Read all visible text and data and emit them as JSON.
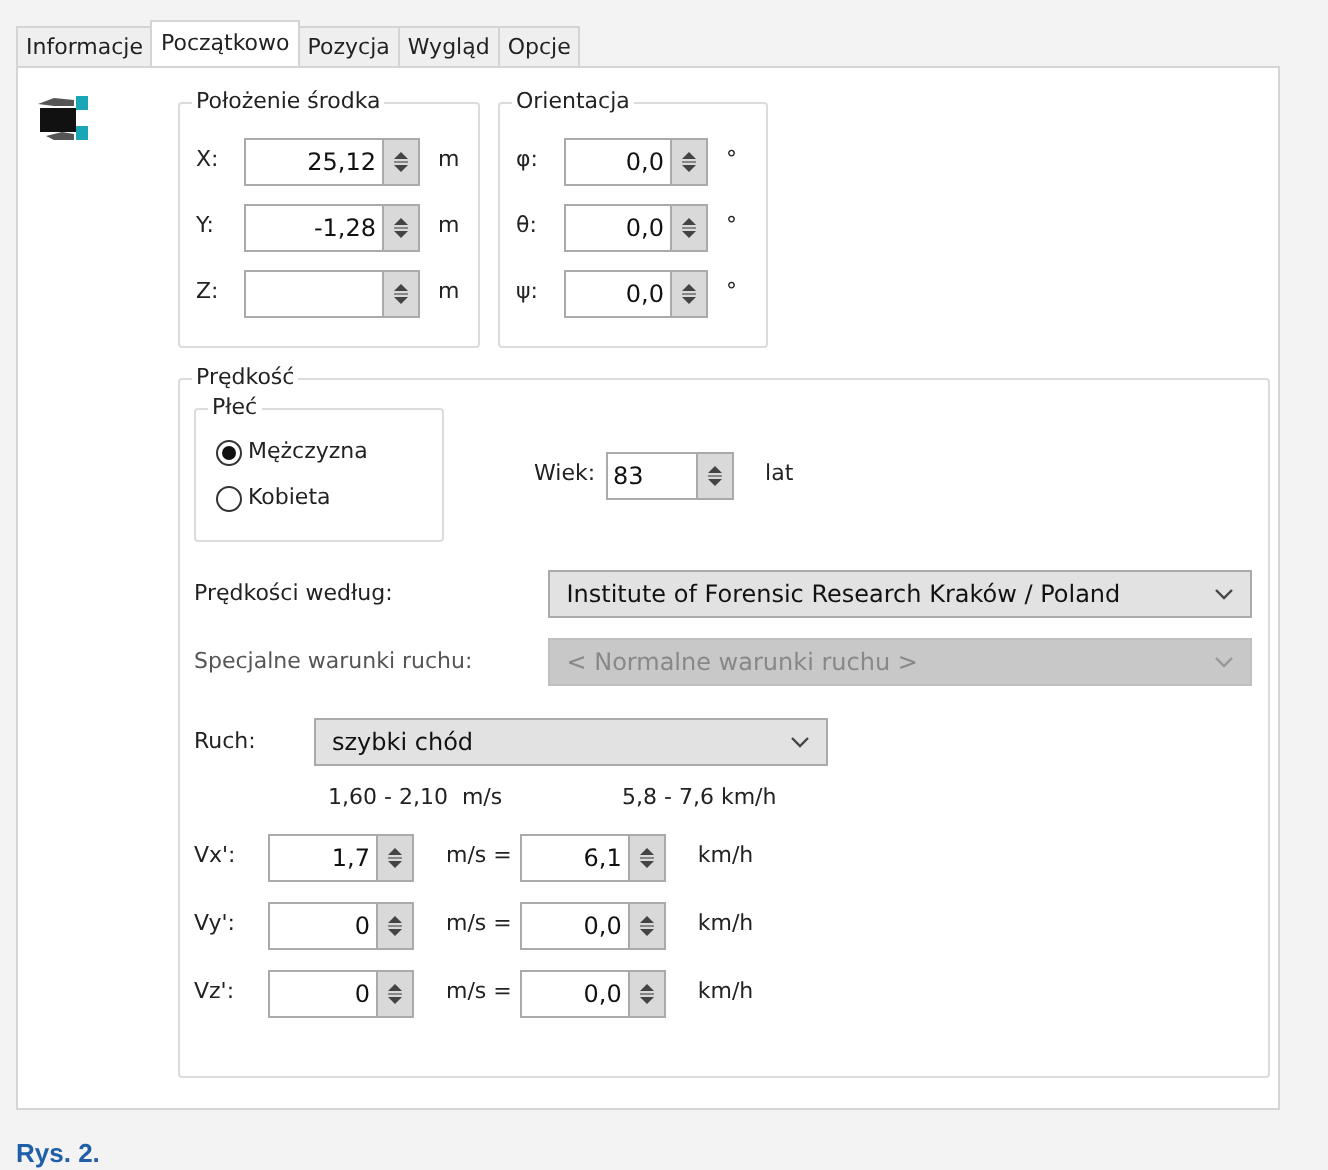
{
  "tabs": [
    {
      "label": "Informacje",
      "selected": false
    },
    {
      "label": "Początkowo",
      "selected": true
    },
    {
      "label": "Pozycja",
      "selected": false
    },
    {
      "label": "Wygląd",
      "selected": false
    },
    {
      "label": "Opcje",
      "selected": false
    }
  ],
  "position": {
    "title": "Położenie środka",
    "fields": [
      {
        "label": "X:",
        "value": "25,12",
        "unit": "m"
      },
      {
        "label": "Y:",
        "value": "-1,28",
        "unit": "m"
      },
      {
        "label": "Z:",
        "unit": "m"
      }
    ]
  },
  "orientation": {
    "title": "Orientacja",
    "fields": [
      {
        "label": "φ:",
        "value": "0,0",
        "unit": "°"
      },
      {
        "label": "θ:",
        "value": "0,0",
        "unit": "°"
      },
      {
        "label": "ψ:",
        "value": "0,0",
        "unit": "°"
      }
    ]
  },
  "speed": {
    "title": "Prędkość",
    "gender": {
      "title": "Płeć",
      "options": [
        {
          "label": "Mężczyzna",
          "selected": true
        },
        {
          "label": "Kobieta",
          "selected": false
        }
      ]
    },
    "age": {
      "label": "Wiek:",
      "value": "83",
      "unit": "lat"
    },
    "selects": [
      {
        "label": "Prędkości według:",
        "value": "Institute of Forensic Research Kraków / Poland",
        "disabled": false
      },
      {
        "label": "Specjalne warunki ruchu:",
        "value": "< Normalne warunki ruchu >",
        "disabled": true
      }
    ],
    "movement": {
      "label": "Ruch:",
      "value": "szybki chód"
    },
    "range_ms": "1,60 - 2,10  m/s",
    "range_kmh": "5,8 - 7,6 km/h",
    "velocities": [
      {
        "label": "Vx':",
        "ms": "1,7",
        "ms_unit": "m/s =",
        "kmh": "6,1",
        "kmh_unit": "km/h"
      },
      {
        "label": "Vy':",
        "ms": "0",
        "ms_unit": "m/s =",
        "kmh": "0,0",
        "kmh_unit": "km/h"
      },
      {
        "label": "Vz':",
        "ms": "0",
        "ms_unit": "m/s =",
        "kmh": "0,0",
        "kmh_unit": "km/h"
      }
    ]
  },
  "caption": "Rys. 2."
}
